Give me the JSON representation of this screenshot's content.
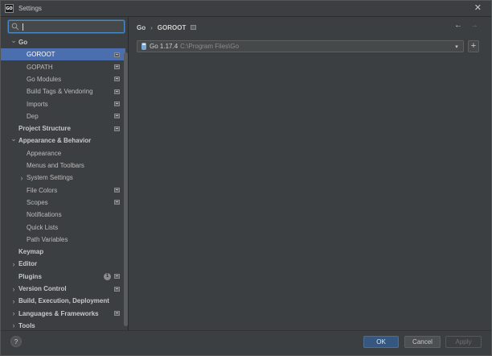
{
  "window": {
    "app_icon_text": "GO",
    "title": "Settings",
    "close_glyph": "✕"
  },
  "search": {
    "value": "",
    "placeholder": ""
  },
  "tree": [
    {
      "label": "Go",
      "level": 0,
      "expandable": true,
      "expanded": true,
      "bold": true,
      "selected": false,
      "project_icon": false
    },
    {
      "label": "GOROOT",
      "level": 1,
      "expandable": false,
      "bold": false,
      "selected": true,
      "project_icon": true
    },
    {
      "label": "GOPATH",
      "level": 1,
      "expandable": false,
      "bold": false,
      "selected": false,
      "project_icon": true
    },
    {
      "label": "Go Modules",
      "level": 1,
      "expandable": false,
      "bold": false,
      "selected": false,
      "project_icon": true
    },
    {
      "label": "Build Tags & Vendoring",
      "level": 1,
      "expandable": false,
      "bold": false,
      "selected": false,
      "project_icon": true
    },
    {
      "label": "Imports",
      "level": 1,
      "expandable": false,
      "bold": false,
      "selected": false,
      "project_icon": true
    },
    {
      "label": "Dep",
      "level": 1,
      "expandable": false,
      "bold": false,
      "selected": false,
      "project_icon": true
    },
    {
      "label": "Project Structure",
      "level": 0,
      "expandable": false,
      "bold": true,
      "selected": false,
      "project_icon": true
    },
    {
      "label": "Appearance & Behavior",
      "level": 0,
      "expandable": true,
      "expanded": true,
      "bold": true,
      "selected": false,
      "project_icon": false
    },
    {
      "label": "Appearance",
      "level": 1,
      "expandable": false,
      "bold": false,
      "selected": false,
      "project_icon": false
    },
    {
      "label": "Menus and Toolbars",
      "level": 1,
      "expandable": false,
      "bold": false,
      "selected": false,
      "project_icon": false
    },
    {
      "label": "System Settings",
      "level": 1,
      "expandable": true,
      "expanded": false,
      "bold": false,
      "selected": false,
      "project_icon": false
    },
    {
      "label": "File Colors",
      "level": 1,
      "expandable": false,
      "bold": false,
      "selected": false,
      "project_icon": true
    },
    {
      "label": "Scopes",
      "level": 1,
      "expandable": false,
      "bold": false,
      "selected": false,
      "project_icon": true
    },
    {
      "label": "Notifications",
      "level": 1,
      "expandable": false,
      "bold": false,
      "selected": false,
      "project_icon": false
    },
    {
      "label": "Quick Lists",
      "level": 1,
      "expandable": false,
      "bold": false,
      "selected": false,
      "project_icon": false
    },
    {
      "label": "Path Variables",
      "level": 1,
      "expandable": false,
      "bold": false,
      "selected": false,
      "project_icon": false
    },
    {
      "label": "Keymap",
      "level": 0,
      "expandable": false,
      "bold": true,
      "selected": false,
      "project_icon": false
    },
    {
      "label": "Editor",
      "level": 0,
      "expandable": true,
      "expanded": false,
      "bold": true,
      "selected": false,
      "project_icon": false
    },
    {
      "label": "Plugins",
      "level": 0,
      "expandable": false,
      "bold": true,
      "selected": false,
      "project_icon": true,
      "badge": "1"
    },
    {
      "label": "Version Control",
      "level": 0,
      "expandable": true,
      "expanded": false,
      "bold": true,
      "selected": false,
      "project_icon": true
    },
    {
      "label": "Build, Execution, Deployment",
      "level": 0,
      "expandable": true,
      "expanded": false,
      "bold": true,
      "selected": false,
      "project_icon": false
    },
    {
      "label": "Languages & Frameworks",
      "level": 0,
      "expandable": true,
      "expanded": false,
      "bold": true,
      "selected": false,
      "project_icon": true
    },
    {
      "label": "Tools",
      "level": 0,
      "expandable": true,
      "expanded": false,
      "bold": true,
      "selected": false,
      "project_icon": false
    }
  ],
  "breadcrumb": {
    "parent": "Go",
    "separator": "›",
    "current": "GOROOT"
  },
  "nav": {
    "back_glyph": "←",
    "forward_glyph": "→"
  },
  "sdk": {
    "name": "Go 1.17.4",
    "path": "C:\\Program Files\\Go",
    "add_glyph": "+"
  },
  "footer": {
    "help": "?",
    "ok": "OK",
    "cancel": "Cancel",
    "apply": "Apply"
  },
  "colors": {
    "selection": "#4b6eaf",
    "ok_button": "#365880",
    "focus_border": "#4a88c7"
  }
}
